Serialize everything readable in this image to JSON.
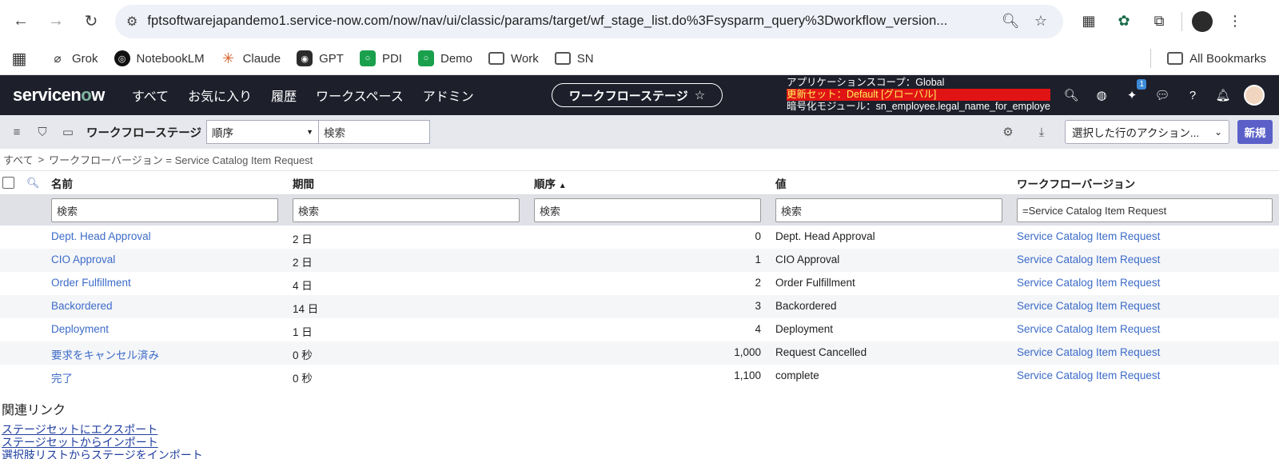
{
  "browser": {
    "url": "fptsoftwarejapandemo1.service-now.com/now/nav/ui/classic/params/target/wf_stage_list.do%3Fsysparm_query%3Dworkflow_version...",
    "bookmarks": [
      "Grok",
      "NotebookLM",
      "Claude",
      "GPT",
      "PDI",
      "Demo",
      "Work",
      "SN"
    ],
    "all_bookmarks": "All Bookmarks"
  },
  "sn": {
    "logo": "servicenow",
    "menu": [
      "すべて",
      "お気に入り",
      "履歴",
      "ワークスペース",
      "アドミン"
    ],
    "current_page": "ワークフローステージ",
    "scope_line1": "アプリケーションスコープ：Global",
    "scope_line2": "更新セット：Default [グローバル]",
    "scope_line3": "暗号化モジュール：sn_employee.legal_name_for_employe...",
    "notif_badge": "1"
  },
  "toolbar": {
    "title": "ワークフローステージ",
    "sort_field": "順序",
    "search_placeholder": "検索",
    "action_select": "選択した行のアクション...",
    "new_label": "新規"
  },
  "breadcrumb": {
    "root": "すべて",
    "sep": ">",
    "filter": "ワークフローバージョン = Service Catalog Item Request"
  },
  "table": {
    "columns": [
      "名前",
      "期間",
      "順序",
      "値",
      "ワークフローバージョン"
    ],
    "sort_indicator": "▲",
    "filters": [
      "検索",
      "検索",
      "検索",
      "検索",
      "=Service Catalog Item Request"
    ],
    "rows": [
      {
        "name": "Dept. Head Approval",
        "duration": "2 日",
        "order": "0",
        "value": "Dept. Head Approval",
        "version": "Service Catalog Item Request"
      },
      {
        "name": "CIO Approval",
        "duration": "2 日",
        "order": "1",
        "value": "CIO Approval",
        "version": "Service Catalog Item Request"
      },
      {
        "name": "Order Fulfillment",
        "duration": "4 日",
        "order": "2",
        "value": "Order Fulfillment",
        "version": "Service Catalog Item Request"
      },
      {
        "name": "Backordered",
        "duration": "14 日",
        "order": "3",
        "value": "Backordered",
        "version": "Service Catalog Item Request"
      },
      {
        "name": "Deployment",
        "duration": "1 日",
        "order": "4",
        "value": "Deployment",
        "version": "Service Catalog Item Request"
      },
      {
        "name": "要求をキャンセル済み",
        "duration": "0 秒",
        "order": "1,000",
        "value": "Request Cancelled",
        "version": "Service Catalog Item Request"
      },
      {
        "name": "完了",
        "duration": "0 秒",
        "order": "1,100",
        "value": "complete",
        "version": "Service Catalog Item Request"
      }
    ]
  },
  "related": {
    "title": "関連リンク",
    "links": [
      "ステージセットにエクスポート",
      "ステージセットからインポート",
      "選択肢リストからステージをインポート"
    ]
  }
}
